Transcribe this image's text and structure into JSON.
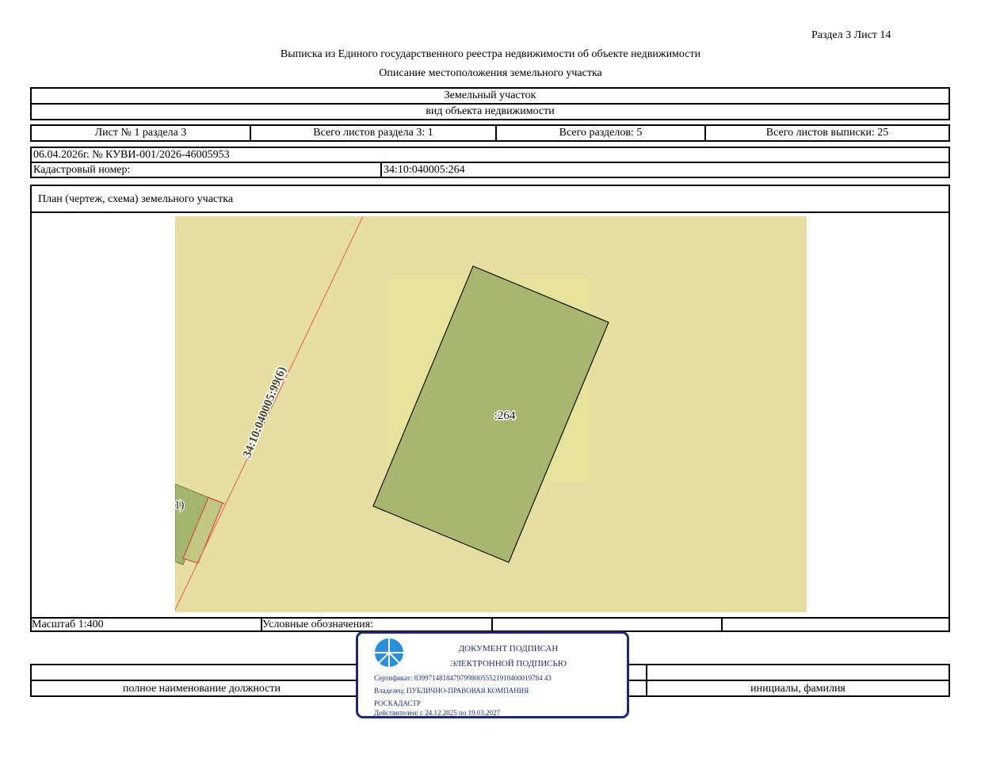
{
  "header": {
    "section_sheet": "Раздел 3   Лист 14",
    "title": "Выписка из Единого государственного реестра недвижимости об объекте недвижимости",
    "subtitle": "Описание местоположения земельного участка"
  },
  "object": {
    "type": "Земельный участок",
    "type_caption": "вид объекта недвижимости"
  },
  "sheets": {
    "sheet": "Лист № 1 раздела 3",
    "total_sheets_section": "Всего листов раздела 3: 1",
    "total_sections": "Всего разделов: 5",
    "total_sheets_extract": "Всего листов выписки: 25"
  },
  "record": {
    "date_number": "06.04.2026г. № КУВИ-001/2026-46005953",
    "cadastral_label": "Кадастровый номер:",
    "cadastral_value": "34:10:040005:264"
  },
  "plan": {
    "title": "План (чертеж, схема) земельного участка",
    "parcel_label": ":264",
    "boundary_label": "34:10:040005:99(6)",
    "partial_label": "1)",
    "colors": {
      "background": "#e6dfa1",
      "light_square": "#e5e39c",
      "parcel": "#a9b66f",
      "left_parcel": "#a4b56d",
      "boundary_line": "#e85a5a"
    }
  },
  "legend": {
    "scale": "Масштаб 1:400",
    "legend_label": "Условные обозначения:"
  },
  "signature_row": {
    "position_caption": "полное наименование должности",
    "name_caption": "инициалы, фамилия"
  },
  "stamp": {
    "line1": "ДОКУМЕНТ ПОДПИСАН",
    "line2": "ЭЛЕКТРОННОЙ ПОДПИСЬЮ",
    "certificate": "Сертификат: 839971481847979980055521910400019784 43",
    "owner_line1": "Владелец: ПУБЛИЧНО-ПРАВОВАЯ КОМПАНИЯ",
    "owner_line2": "РОСКАДАСТР",
    "valid": "Действителен: с 24.12.2025 по 19.03.2027",
    "colors": {
      "border": "#1a2a6c",
      "text": "#1e2f7a",
      "logo": "#2a8fd6"
    }
  }
}
